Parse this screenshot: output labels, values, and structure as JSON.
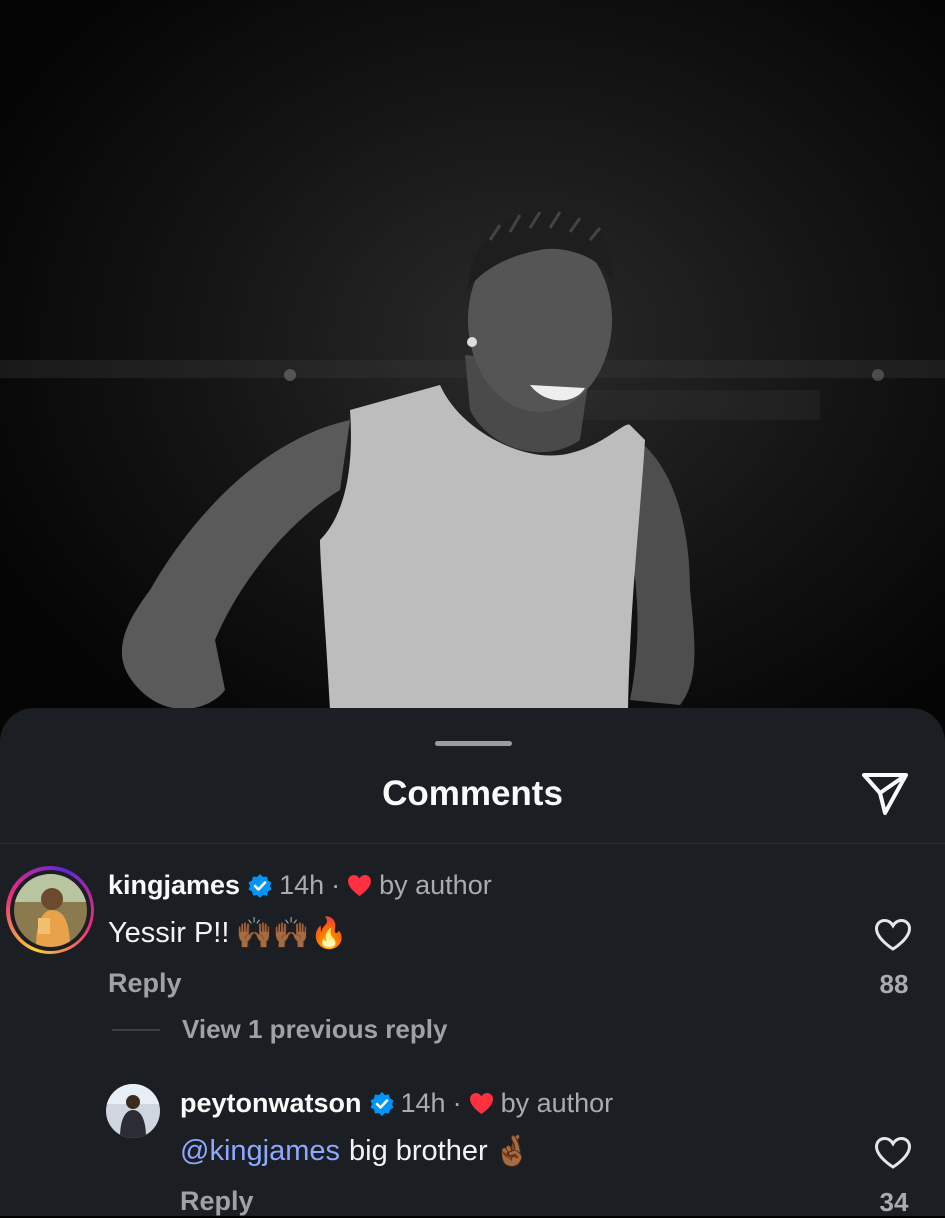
{
  "post_image": {
    "description_icon": "person-photo"
  },
  "sheet": {
    "title": "Comments",
    "share_icon": "send-icon"
  },
  "comments": [
    {
      "username": "kingjames",
      "verified": true,
      "time": "14h",
      "separator": "·",
      "liked_by_author": "by author",
      "text": "Yessir P!!",
      "emojis": "🙌🏾🙌🏾🔥",
      "reply_label": "Reply",
      "likes": "88"
    }
  ],
  "view_previous": "View 1 previous reply",
  "replies": [
    {
      "username": "peytonwatson",
      "verified": true,
      "time": "14h",
      "separator": "·",
      "liked_by_author": "by author",
      "mention": "@kingjames",
      "text": "big brother",
      "emojis": "🤞🏾",
      "reply_label": "Reply",
      "likes": "34"
    }
  ],
  "colors": {
    "sheet_bg": "#1b1e23",
    "verified_blue": "#0095f6",
    "heart_red": "#ff3040",
    "mention_blue": "#8fa8ff"
  }
}
